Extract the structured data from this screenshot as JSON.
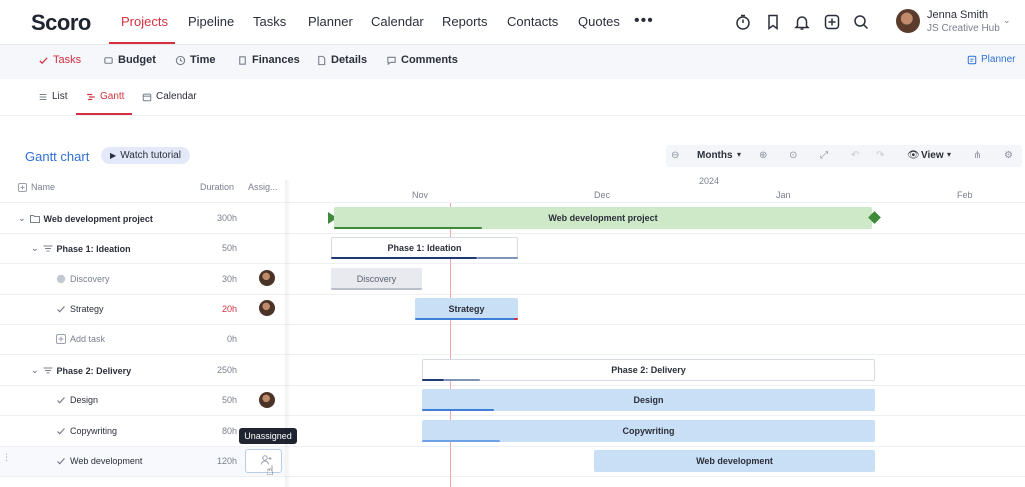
{
  "app": {
    "logo": "Scoro"
  },
  "nav": {
    "items": [
      "Projects",
      "Pipeline",
      "Tasks",
      "Planner",
      "Calendar",
      "Reports",
      "Contacts",
      "Quotes"
    ],
    "active": "Projects",
    "more": "•••"
  },
  "user": {
    "name": "Jenna Smith",
    "org": "JS Creative Hub"
  },
  "subnav": {
    "items": [
      "Tasks",
      "Budget",
      "Time",
      "Finances",
      "Details",
      "Comments"
    ],
    "active": "Tasks",
    "planner_link": "Planner"
  },
  "views": {
    "items": [
      "List",
      "Gantt",
      "Calendar"
    ],
    "active": "Gantt"
  },
  "gantt": {
    "title": "Gantt chart",
    "watch_tutorial": "Watch tutorial",
    "zoom": "Months",
    "view_label": "View",
    "columns": {
      "name": "Name",
      "duration": "Duration",
      "assignee": "Assig..."
    },
    "year": "2024",
    "months": [
      "Nov",
      "Dec",
      "Jan",
      "Feb"
    ],
    "rows": [
      {
        "name": "Web development project",
        "duration": "300h",
        "type": "project"
      },
      {
        "name": "Phase 1: Ideation",
        "duration": "50h",
        "type": "phase"
      },
      {
        "name": "Discovery",
        "duration": "30h",
        "type": "task",
        "status": "done"
      },
      {
        "name": "Strategy",
        "duration": "20h",
        "type": "task",
        "overdue": true
      },
      {
        "name": "Add task",
        "duration": "0h",
        "type": "add"
      },
      {
        "name": "Phase 2: Delivery",
        "duration": "250h",
        "type": "phase"
      },
      {
        "name": "Design",
        "duration": "50h",
        "type": "task"
      },
      {
        "name": "Copywriting",
        "duration": "80h",
        "type": "task"
      },
      {
        "name": "Web development",
        "duration": "120h",
        "type": "task",
        "assignee": "Unassigned"
      }
    ],
    "bars": {
      "project": "Web development project",
      "phase1": "Phase 1: Ideation",
      "discovery": "Discovery",
      "strategy": "Strategy",
      "phase2": "Phase 2: Delivery",
      "design": "Design",
      "copywriting": "Copywriting",
      "webdev": "Web development"
    },
    "tooltip": "Unassigned"
  },
  "colors": {
    "accent": "#d6303f",
    "link": "#2f6fd6",
    "project_bar": "#cde9c7",
    "task_bar": "#c9dff6",
    "milestone": "#3f8a3a"
  }
}
